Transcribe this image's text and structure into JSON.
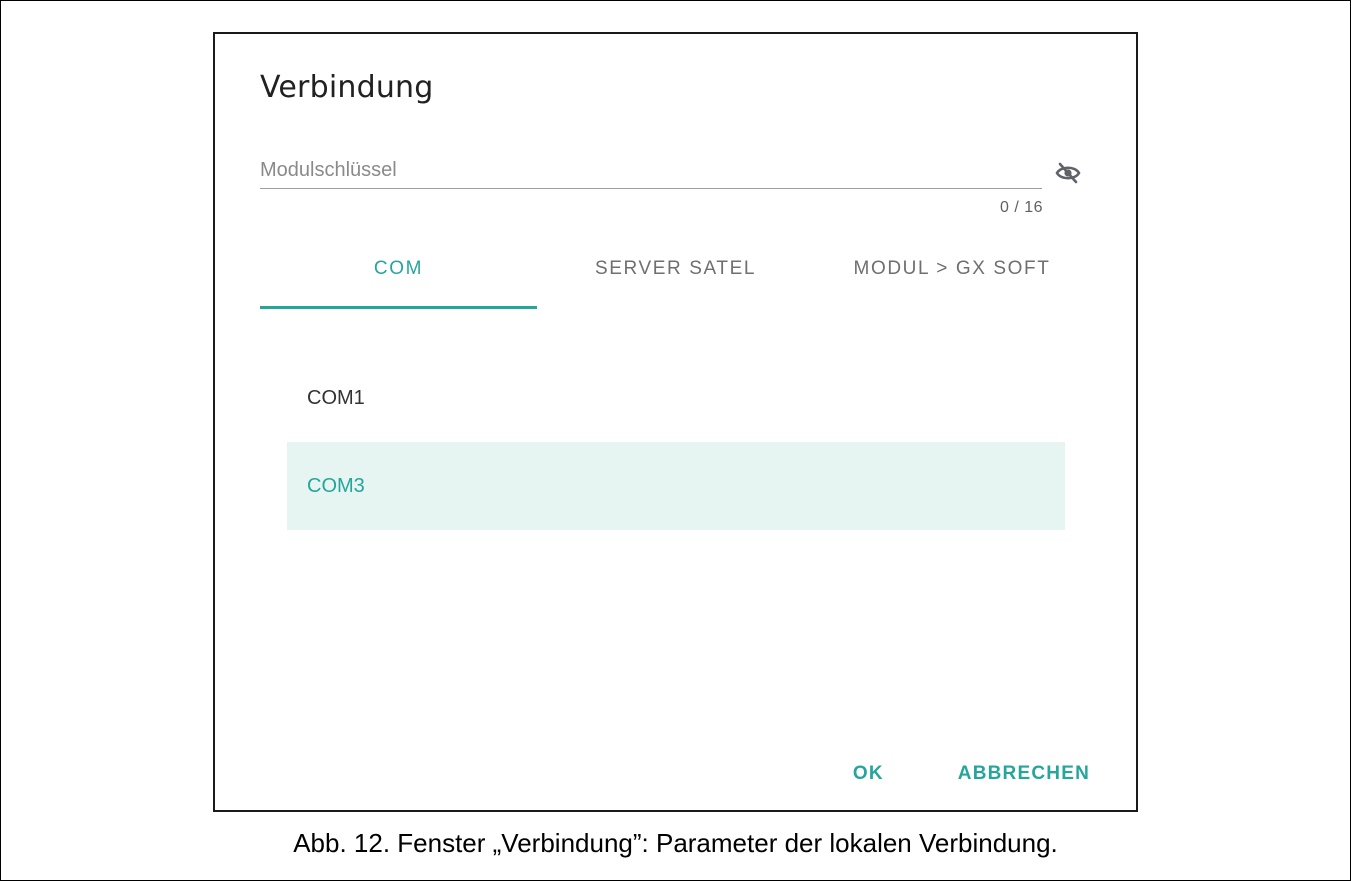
{
  "dialog": {
    "title": "Verbindung",
    "module_key": {
      "placeholder": "Modulschlüssel",
      "value": "",
      "counter": "0 / 16",
      "visibility_icon": "eye-off-icon"
    },
    "tabs": [
      {
        "label": "COM",
        "active": true
      },
      {
        "label": "SERVER SATEL",
        "active": false
      },
      {
        "label": "MODUL > GX SOFT",
        "active": false
      }
    ],
    "ports": [
      {
        "label": "COM1",
        "selected": false
      },
      {
        "label": "COM3",
        "selected": true
      }
    ],
    "actions": {
      "ok_label": "OK",
      "cancel_label": "ABBRECHEN"
    }
  },
  "caption": "Abb. 12. Fenster „Verbindung”: Parameter der lokalen Verbindung.",
  "colors": {
    "accent": "#26a69a",
    "selected_bg": "#e6f4f2",
    "text_primary": "#212121",
    "text_secondary": "#6f6f6f"
  }
}
